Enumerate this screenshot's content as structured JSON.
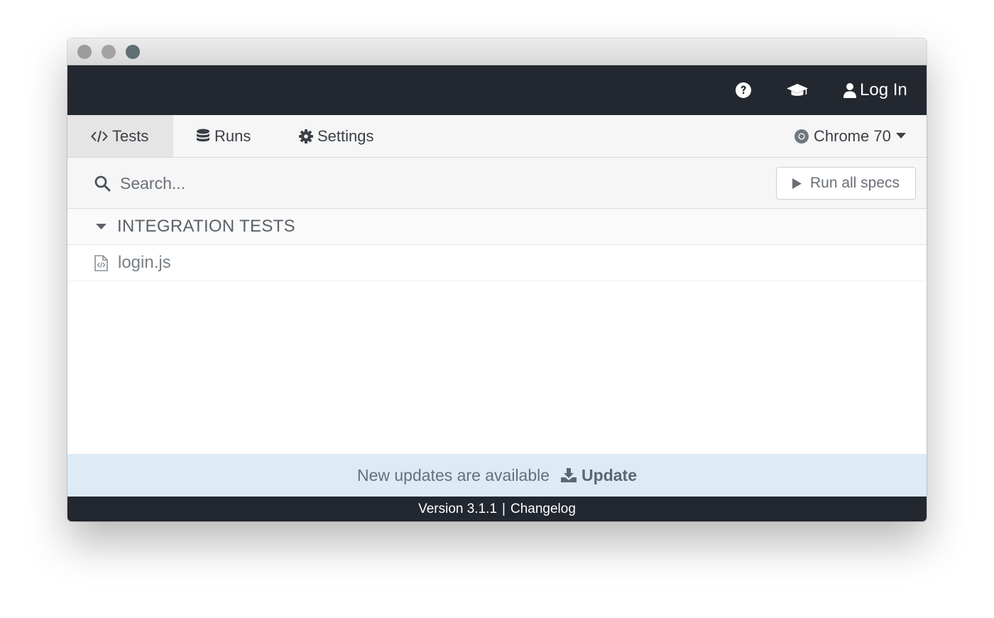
{
  "header": {
    "help_icon": "question-circle-icon",
    "docs_icon": "graduation-cap-icon",
    "login_icon": "user-icon",
    "login_label": "Log In"
  },
  "nav": {
    "tabs": [
      {
        "label": "Tests",
        "icon": "code-icon",
        "active": true
      },
      {
        "label": "Runs",
        "icon": "database-icon",
        "active": false
      },
      {
        "label": "Settings",
        "icon": "gear-icon",
        "active": false
      }
    ],
    "browser": {
      "label": "Chrome 70",
      "icon": "chrome-icon"
    }
  },
  "search": {
    "placeholder": "Search...",
    "run_all_label": "Run all specs"
  },
  "specs": {
    "section_label": "INTEGRATION TESTS",
    "files": [
      {
        "name": "login.js",
        "icon": "file-code-icon"
      }
    ]
  },
  "update": {
    "message": "New updates are available",
    "action_label": "Update",
    "action_icon": "download-icon"
  },
  "footer": {
    "version": "Version 3.1.1",
    "separator": "|",
    "changelog": "Changelog"
  },
  "colors": {
    "header_bg": "#23272f",
    "update_bg": "#dcebf6",
    "nav_bg": "#f6f6f6"
  }
}
